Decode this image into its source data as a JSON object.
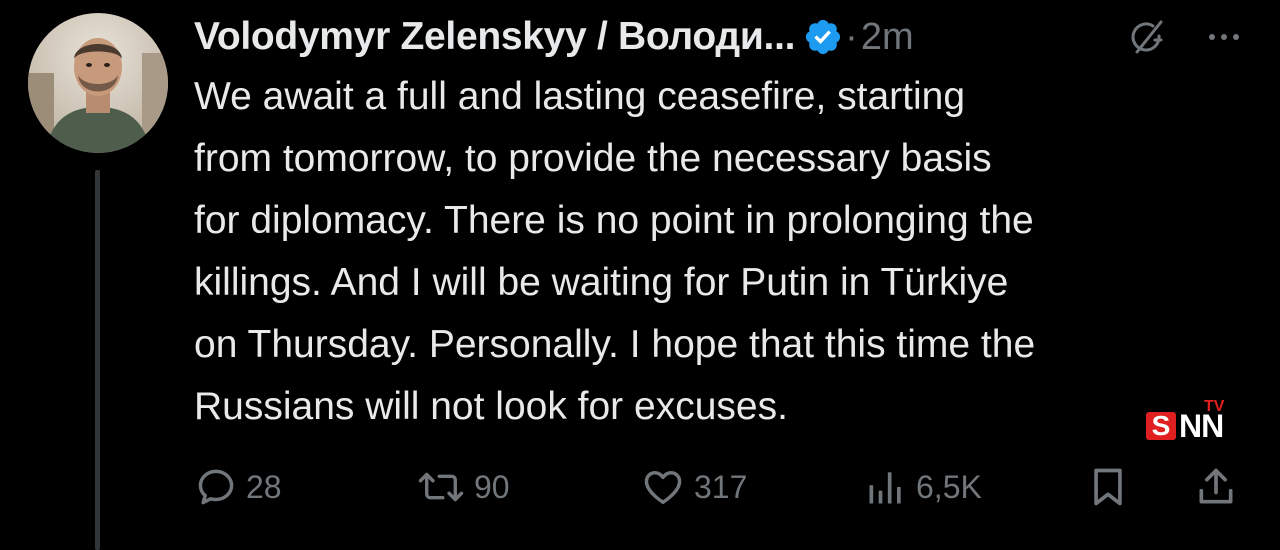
{
  "tweet": {
    "author": "Volodymyr Zelenskyy / Володи...",
    "verified": true,
    "separator": "·",
    "time": "2m",
    "text_lines": [
      "We await a full and lasting ceasefire, starting",
      "from tomorrow, to provide the necessary basis",
      "for diplomacy. There is no point in prolonging the",
      "killings. And I will be waiting for Putin in Türkiye",
      "on Thursday. Personally. I hope that this time the",
      "Russians will not look for excuses."
    ]
  },
  "actions": {
    "replies": "28",
    "reposts": "90",
    "likes": "317",
    "views": "6,5K"
  },
  "watermark": {
    "letter": "S",
    "rest": "NN",
    "suffix": "TV"
  },
  "colors": {
    "background": "#000000",
    "text": "#e7e9ea",
    "muted": "#71767b",
    "verified": "#1d9bf0",
    "watermark_red": "#e02020"
  },
  "icons": [
    "grok-icon",
    "more-icon",
    "reply-icon",
    "repost-icon",
    "like-icon",
    "views-icon",
    "bookmark-icon",
    "share-icon",
    "verified-badge-icon"
  ]
}
